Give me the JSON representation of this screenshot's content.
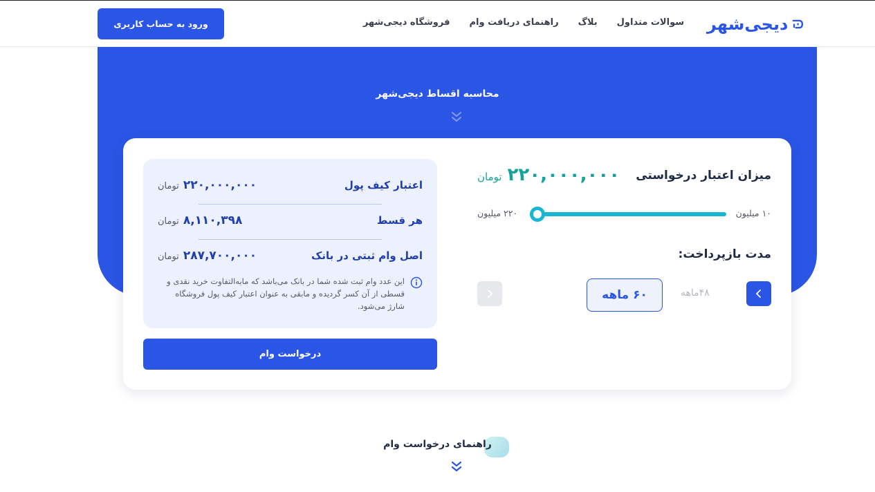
{
  "header": {
    "logo_text": "دیجی‌شهر",
    "nav": [
      "فروشگاه دیجی‌شهر",
      "راهنمای دریافت وام",
      "بلاگ",
      "سوالات متداول"
    ],
    "login_label": "ورود به حساب کاربری"
  },
  "hero": {
    "title": "محاسبه اقساط دیجی‌شهر"
  },
  "calculator": {
    "requested_label": "میزان اعتبار درخواستی",
    "requested_value": "۲۲۰,۰۰۰,۰۰۰",
    "requested_unit": "تومان",
    "slider_min_label": "۱۰ میلیون",
    "slider_max_label": "۲۲۰ میلیون",
    "slider_value_fraction": 1.0,
    "term_label": "مدت بازپرداخت:",
    "term_option_prev": "۴۸ماهه",
    "term_option_selected": "۶۰ ماهه"
  },
  "summary": {
    "rows": [
      {
        "label": "اعتبار کیف پول",
        "value": "۲۲۰,۰۰۰,۰۰۰",
        "unit": "تومان"
      },
      {
        "label": "هر قسط",
        "value": "۸,۱۱۰,۳۹۸",
        "unit": "تومان"
      },
      {
        "label": "اصل وام ثبتی در بانک",
        "value": "۲۸۷,۷۰۰,۰۰۰",
        "unit": "تومان"
      }
    ],
    "note": "این عدد وام ثبت شده شما در بانک می‌باشد که مابه‌التفاوت خرید نقدی و قسطی از آن کسر گردیده و مابقی به عنوان اعتبار کیف پول فروشگاه شارژ می‌شود.",
    "apply_label": "درخواست وام"
  },
  "guide": {
    "title": "راهنمای درخواست وام"
  },
  "colors": {
    "primary": "#2a55e5",
    "accent_teal": "#13a39a",
    "slider": "#16b6d4"
  }
}
